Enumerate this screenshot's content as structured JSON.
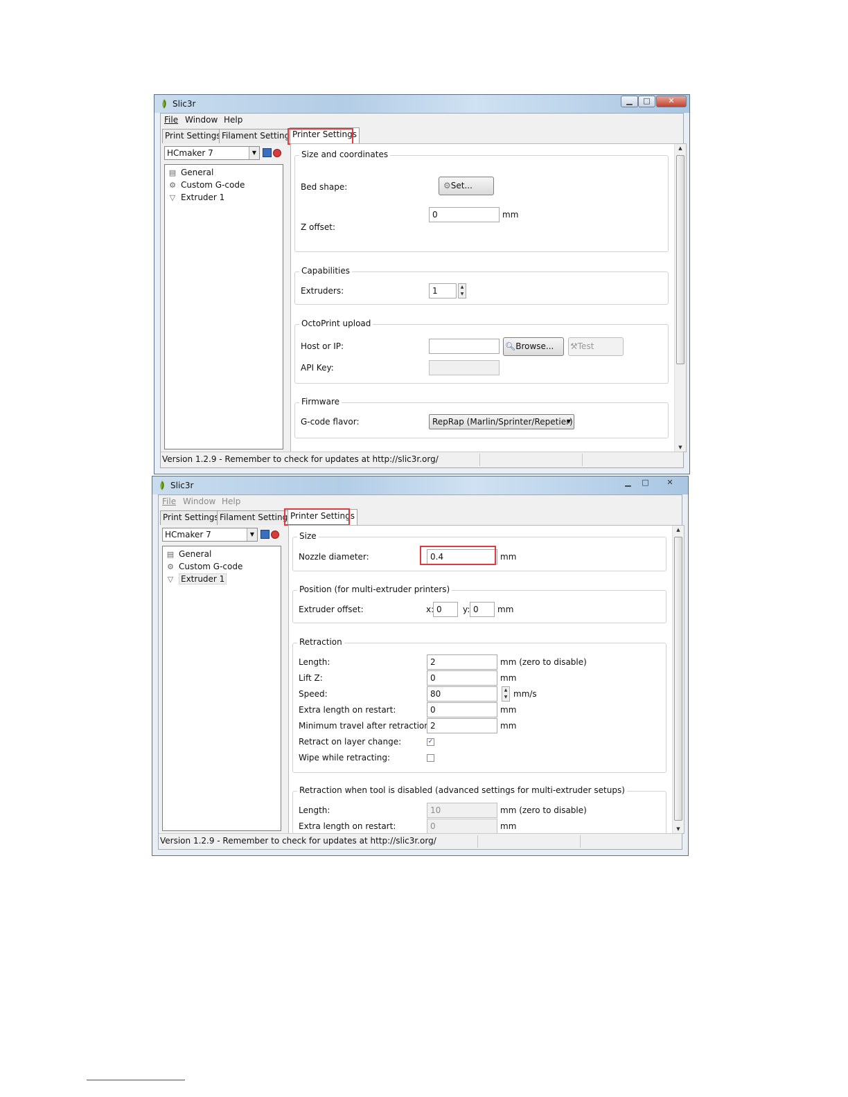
{
  "windows": [
    {
      "title": "Slic3r",
      "menu": {
        "file": "File",
        "window": "Window",
        "help": "Help"
      },
      "tabs": {
        "print": "Print Settings",
        "filament": "Filament Settings",
        "printer": "Printer Settings"
      },
      "preset": "HCmaker 7",
      "tree": {
        "general": "General",
        "custom_gcode": "Custom G-code",
        "extruder": "Extruder 1"
      },
      "size_coords": {
        "title": "Size and coordinates",
        "bed_shape_label": "Bed shape:",
        "set_button": "Set...",
        "z_offset_label": "Z offset:",
        "z_offset_value": "0",
        "z_offset_unit": "mm"
      },
      "capabilities": {
        "title": "Capabilities",
        "extruders_label": "Extruders:",
        "extruders_value": "1"
      },
      "octoprint": {
        "title": "OctoPrint upload",
        "host_label": "Host or IP:",
        "host_value": "",
        "browse_button": "Browse...",
        "test_button": "Test",
        "api_label": "API Key:",
        "api_value": ""
      },
      "firmware": {
        "title": "Firmware",
        "flavor_label": "G-code flavor:",
        "flavor_value": "RepRap (Marlin/Sprinter/Repetier)"
      },
      "status": "Version 1.2.9 - Remember to check for updates at http://slic3r.org/"
    },
    {
      "title": "Slic3r",
      "menu": {
        "file": "File",
        "window": "Window",
        "help": "Help"
      },
      "tabs": {
        "print": "Print Settings",
        "filament": "Filament Settings",
        "printer": "Printer Settings"
      },
      "preset": "HCmaker 7",
      "tree": {
        "general": "General",
        "custom_gcode": "Custom G-code",
        "extruder": "Extruder 1"
      },
      "size": {
        "title": "Size",
        "nozzle_label": "Nozzle diameter:",
        "nozzle_value": "0.4",
        "unit": "mm"
      },
      "position": {
        "title": "Position (for multi-extruder printers)",
        "offset_label": "Extruder offset:",
        "x_label": "x:",
        "x_value": "0",
        "y_label": "y:",
        "y_value": "0",
        "unit": "mm"
      },
      "retraction": {
        "title": "Retraction",
        "length_label": "Length:",
        "length_value": "2",
        "length_unit": "mm (zero to disable)",
        "liftz_label": "Lift Z:",
        "liftz_value": "0",
        "liftz_unit": "mm",
        "speed_label": "Speed:",
        "speed_value": "80",
        "speed_unit": "mm/s",
        "extra_label": "Extra length on restart:",
        "extra_value": "0",
        "extra_unit": "mm",
        "travel_label": "Minimum travel after retraction:",
        "travel_value": "2",
        "travel_unit": "mm",
        "layer_change_label": "Retract on layer change:",
        "layer_change_checked": true,
        "wipe_label": "Wipe while retracting:",
        "wipe_checked": false
      },
      "retraction_disabled": {
        "title": "Retraction when tool is disabled (advanced settings for multi-extruder setups)",
        "length_label": "Length:",
        "length_value": "10",
        "length_unit": "mm (zero to disable)",
        "extra_label": "Extra length on restart:",
        "extra_value": "0",
        "extra_unit": "mm"
      },
      "status": "Version 1.2.9 - Remember to check for updates at http://slic3r.org/"
    }
  ],
  "colors": {
    "highlight": "#e0393e",
    "footer_line": "#2a4fa0"
  },
  "icons": [
    "slic3r-logo-icon",
    "minimize-icon",
    "maximize-icon",
    "close-icon",
    "save-icon",
    "delete-icon",
    "printer-icon",
    "gear-icon",
    "funnel-icon",
    "magnifier-icon",
    "wrench-icon",
    "chevron-down-icon",
    "checkmark-icon"
  ]
}
